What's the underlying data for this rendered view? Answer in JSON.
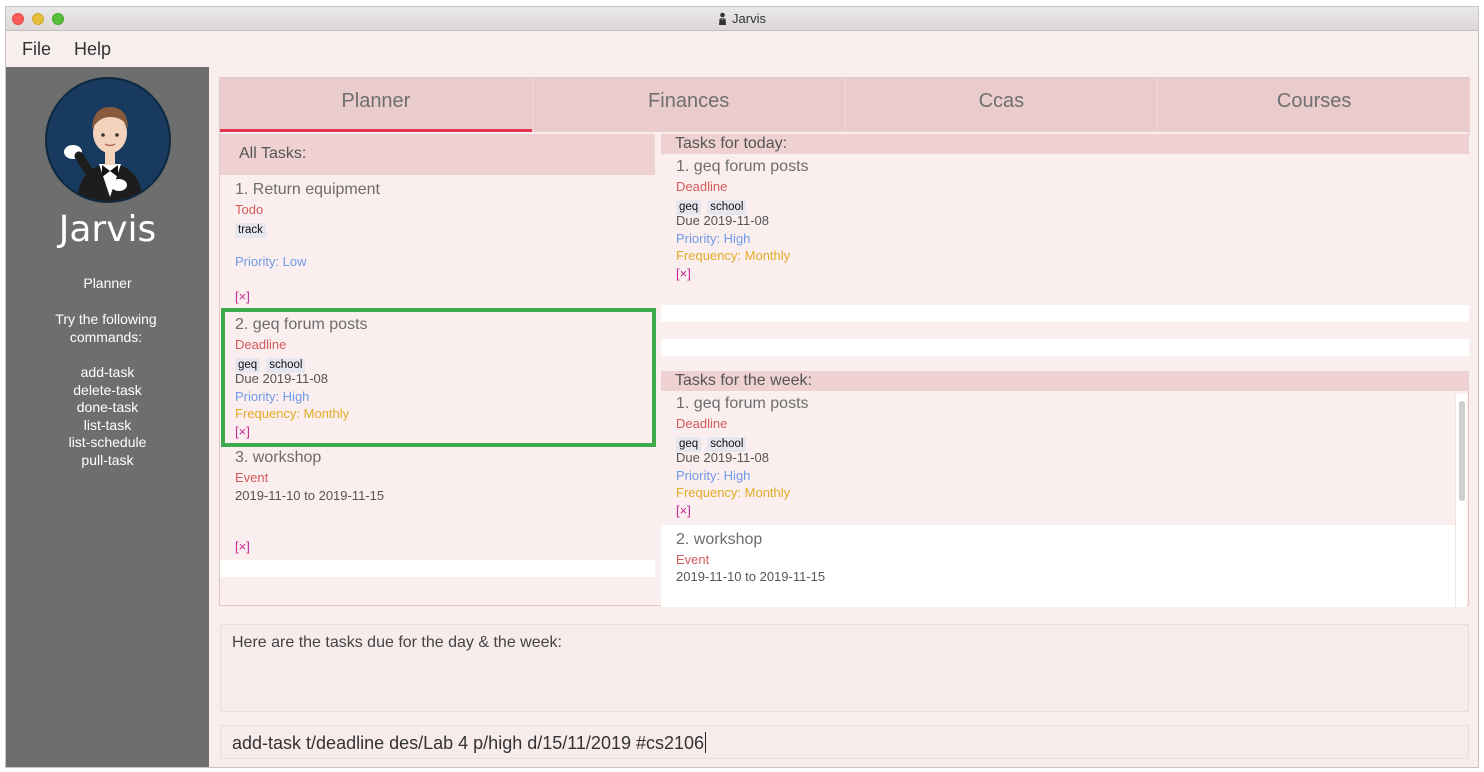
{
  "window": {
    "title": "Jarvis"
  },
  "menu": {
    "file": "File",
    "help": "Help"
  },
  "sidebar": {
    "app_name": "Jarvis",
    "section": "Planner",
    "hint": "Try the following commands:",
    "commands": [
      "add-task",
      "delete-task",
      "done-task",
      "list-task",
      "list-schedule",
      "pull-task"
    ]
  },
  "tabs": [
    {
      "label": "Planner",
      "active": true
    },
    {
      "label": "Finances",
      "active": false
    },
    {
      "label": "Ccas",
      "active": false
    },
    {
      "label": "Courses",
      "active": false
    }
  ],
  "all_tasks": {
    "header": "All Tasks:",
    "items": [
      {
        "title": "1. Return equipment",
        "type": "Todo",
        "tags": [
          "track"
        ],
        "priority": "Priority: Low",
        "delete": "[×]"
      },
      {
        "title": "2. geq forum posts",
        "type": "Deadline",
        "tags": [
          "geq",
          "school"
        ],
        "due": "Due 2019-11-08",
        "priority": "Priority: High",
        "frequency": "Frequency: Monthly",
        "delete": "[×]",
        "selected": true
      },
      {
        "title": "3. workshop",
        "type": "Event",
        "date_range": "2019-11-10 to 2019-11-15",
        "delete": "[×]"
      }
    ]
  },
  "today": {
    "header": "Tasks for today:",
    "items": [
      {
        "title": "1. geq forum posts",
        "type": "Deadline",
        "tags": [
          "geq",
          "school"
        ],
        "due": "Due 2019-11-08",
        "priority": "Priority: High",
        "frequency": "Frequency: Monthly",
        "delete": "[×]"
      }
    ]
  },
  "week": {
    "header": "Tasks for the week:",
    "items": [
      {
        "title": "1. geq forum posts",
        "type": "Deadline",
        "tags": [
          "geq",
          "school"
        ],
        "due": "Due 2019-11-08",
        "priority": "Priority: High",
        "frequency": "Frequency: Monthly",
        "delete": "[×]"
      },
      {
        "title": "2. workshop",
        "type": "Event",
        "date_range": "2019-11-10 to 2019-11-15"
      }
    ]
  },
  "result": {
    "text": "Here are the tasks due for the day & the week:"
  },
  "command": {
    "value": "add-task t/deadline des/Lab 4 p/high d/15/11/2019 #cs2106"
  },
  "colors": {
    "accent": "#e3364e",
    "selection": "#3fa94e",
    "type": "#d35b5b",
    "priority": "#6f9ae6",
    "frequency": "#e2ab27",
    "delete": "#c62a94"
  }
}
